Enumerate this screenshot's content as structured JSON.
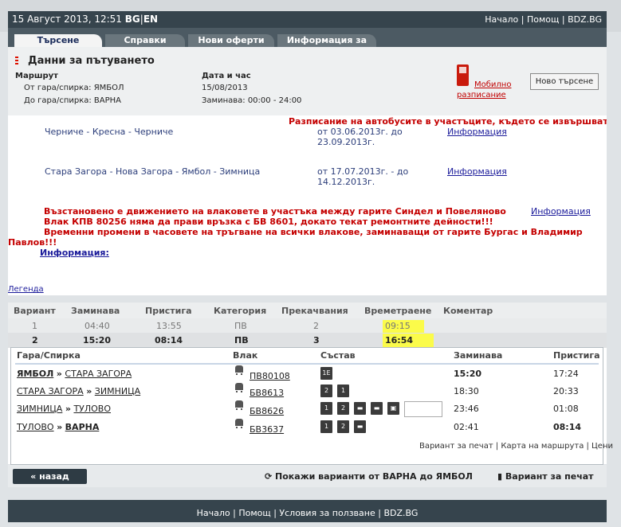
{
  "topbar": {
    "datetime": "15 Август 2013, 12:51",
    "lang_bg": "BG",
    "lang_en": "EN",
    "nav": "Начало | Помощ | BDZ.BG"
  },
  "tabs": [
    "Търсене",
    "Справки",
    "Нови оферти",
    "Информация за гара"
  ],
  "trip": {
    "title": "Данни за пътуването",
    "route_label": "Маршрут",
    "from": "От гара/спирка: ЯМБОЛ",
    "to": "До гара/спирка: ВАРНА",
    "date_label": "Дата и час",
    "date": "15/08/2013",
    "departs": "Заминава: 00:00 - 24:00",
    "mobile": "Мобилно разписание",
    "new_search": "Ново търсене"
  },
  "notices": {
    "bus_title": "Разписание на автобусите в участъците, където се извършват",
    "r1_route": "Черниче - Кресна - Черниче",
    "r1_dates1": "от 03.06.2013г. до",
    "r1_dates2": "23.09.2013г.",
    "r2_route": "Стара Загора - Нова Загора - Ямбол - Зимница",
    "r2_dates1": "от 17.07.2013г. - до",
    "r2_dates2": "14.12.2013г.",
    "info": "Информация",
    "m1": "Възстановено е движението на влаковете в участъка между гарите Синдел и Повеляново",
    "m2": "Влак КПВ 80256 няма да прави връзка с БВ 8601, докато текат ремонтните дейности!!!",
    "m3": "Временни промени в часовете на тръгване на всички влакове, заминаващи от гарите Бургас и Владимир",
    "m4": "Павлов!!!",
    "info2": "Информация:",
    "legend": "Легенда"
  },
  "results": {
    "headers": [
      "Вариант",
      "Заминава",
      "Пристига",
      "Категория",
      "Прекачвания",
      "Времетраене",
      "Коментар"
    ],
    "rows": [
      [
        "1",
        "04:40",
        "13:55",
        "ПВ",
        "2",
        "09:15"
      ],
      [
        "2",
        "15:20",
        "08:14",
        "ПВ",
        "3",
        "16:54"
      ]
    ],
    "detail_headers": [
      "Гара/Спирка",
      "Влак",
      "Състав",
      "Заминава",
      "Пристига"
    ],
    "legs": [
      {
        "from": "ЯМБОЛ",
        "to": "СТАРА ЗАГОРА",
        "train": "ПВ80108",
        "dep": "15:20",
        "arr": "17:24",
        "comp": [
          "1E"
        ]
      },
      {
        "from": "СТАРА ЗАГОРА",
        "to": "ЗИМНИЦА",
        "train": "БВ8613",
        "dep": "18:30",
        "arr": "20:33",
        "comp": [
          "2",
          "1"
        ]
      },
      {
        "from": "ЗИМНИЦА",
        "to": "ТУЛОВО",
        "train": "БВ8626",
        "dep": "23:46",
        "arr": "01:08",
        "comp": [
          "1",
          "2",
          "bed",
          "bed",
          "bag"
        ]
      },
      {
        "from": "ТУЛОВО",
        "to": "ВАРНА",
        "train": "БВ3637",
        "dep": "02:41",
        "arr": "08:14",
        "comp": [
          "1",
          "2",
          "bed"
        ]
      }
    ],
    "sep": "»",
    "foot": "Вариант за печат | Карта на маршрута | Цени"
  },
  "bottom": {
    "back": "« назад",
    "reverse": "Покажи варианти от ВАРНА до ЯМБОЛ",
    "print": "Вариант за печат"
  },
  "footer": "Начало | Помощ | Условия за ползване | BDZ.BG"
}
